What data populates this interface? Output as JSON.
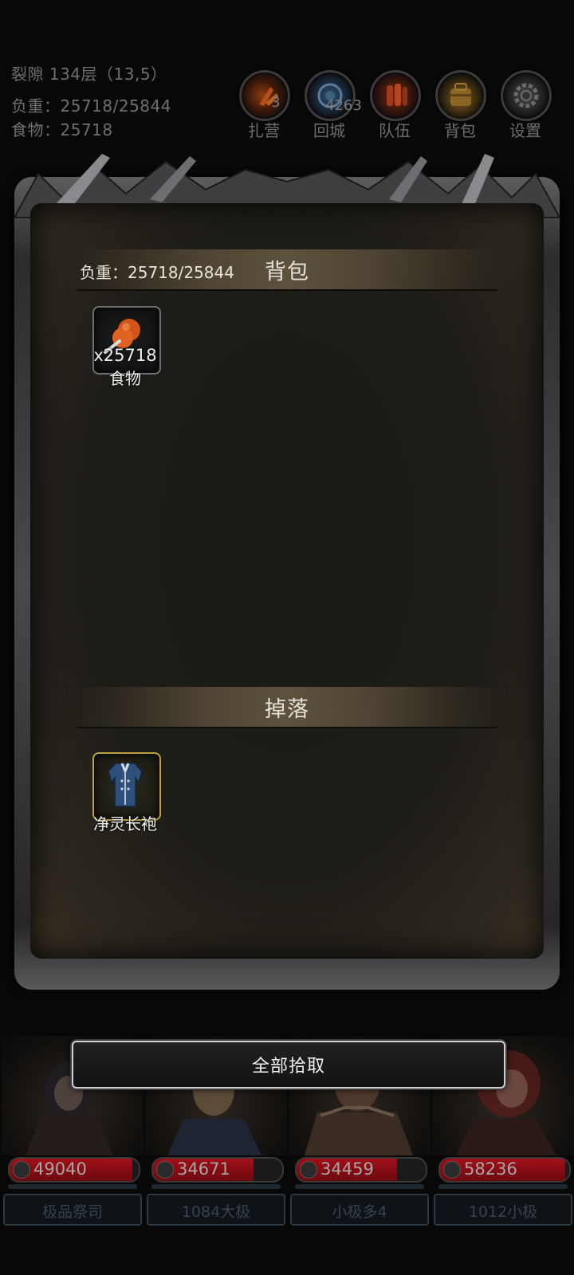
{
  "status": {
    "location": "裂隙 134层（13,5）",
    "weight": "负重：25718/25844",
    "food": "食物：25718"
  },
  "menu": [
    {
      "label": "扎营",
      "icon": "campfire-icon",
      "count": "3"
    },
    {
      "label": "回城",
      "icon": "portal-icon",
      "count": "4263"
    },
    {
      "label": "队伍",
      "icon": "team-icon",
      "count": ""
    },
    {
      "label": "背包",
      "icon": "backpack-icon",
      "count": ""
    },
    {
      "label": "设置",
      "icon": "gear-icon",
      "count": ""
    }
  ],
  "panel": {
    "bag_title": "背包",
    "bag_weight": "负重：25718/25844",
    "drop_title": "掉落"
  },
  "bag_items": [
    {
      "name": "食物",
      "count": "x25718",
      "icon": "meat-food-icon"
    }
  ],
  "drop_items": [
    {
      "name": "净灵长袍",
      "icon": "robe-armor-icon"
    }
  ],
  "pick_all_label": "全部拾取",
  "heroes": [
    {
      "hp": "49040",
      "hp_fraction": 0.95,
      "name": "极品祭司"
    },
    {
      "hp": "34671",
      "hp_fraction": 0.78,
      "name": "1084大极"
    },
    {
      "hp": "34459",
      "hp_fraction": 0.78,
      "name": "小极多4"
    },
    {
      "hp": "58236",
      "hp_fraction": 0.97,
      "name": "1012小极"
    }
  ],
  "colors": {
    "background": "#080808",
    "hp_red": "#a30f18",
    "rare_border": "#b9a238"
  }
}
